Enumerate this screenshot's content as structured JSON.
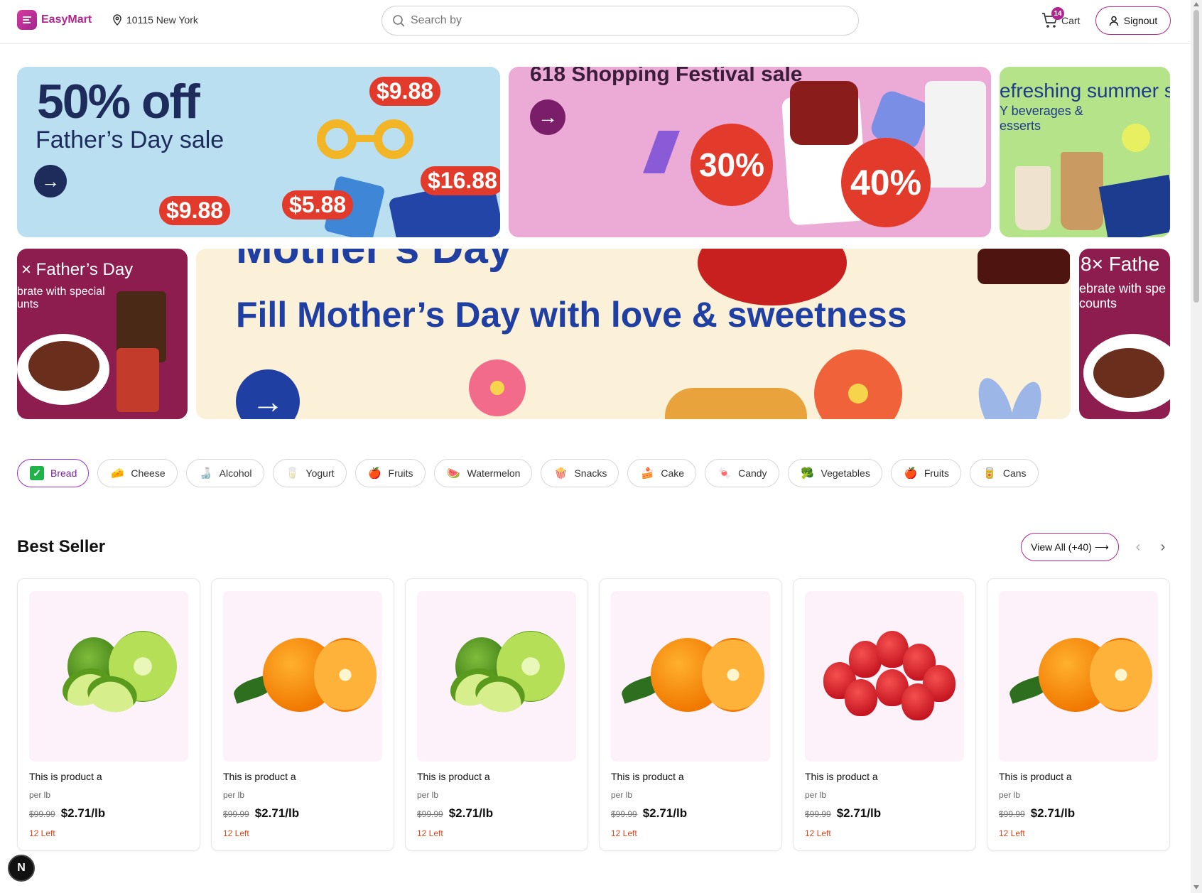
{
  "app": {
    "name": "EasyMart",
    "brand_color": "#b0268e"
  },
  "header": {
    "location": "10115 New York",
    "search_placeholder": "Search by",
    "cart_label": "Cart",
    "cart_count": "14",
    "signout_label": "Signout"
  },
  "banners": {
    "fathers_sale": {
      "headline": "50% off",
      "subtitle": "Father’s Day sale",
      "prices": [
        "$9.88",
        "$9.88",
        "$5.88",
        "$16.88"
      ]
    },
    "festival": {
      "title": "618 Shopping Festival sale",
      "discount_1": "30%",
      "discount_2": "40%"
    },
    "summer": {
      "title": "efreshing summer s",
      "subtitle_1": "Y beverages &",
      "subtitle_2": "esserts"
    },
    "fathers_left": {
      "title": "× Father’s Day",
      "subtitle_1": "brate with special",
      "subtitle_2": "unts"
    },
    "mothers": {
      "title": "Mother’s Day",
      "headline": "Fill Mother’s Day with love & sweetness"
    },
    "fathers_right": {
      "title": "8× Fathe",
      "subtitle_1": "ebrate with spe",
      "subtitle_2": "counts"
    }
  },
  "categories": [
    {
      "label": "Bread",
      "icon": "check-icon",
      "active": true
    },
    {
      "label": "Cheese",
      "icon": "cheese-icon"
    },
    {
      "label": "Alcohol",
      "icon": "alcohol-icon"
    },
    {
      "label": "Yogurt",
      "icon": "yogurt-icon"
    },
    {
      "label": "Fruits",
      "icon": "apple-icon"
    },
    {
      "label": "Watermelon",
      "icon": "watermelon-icon"
    },
    {
      "label": "Snacks",
      "icon": "popcorn-icon"
    },
    {
      "label": "Cake",
      "icon": "cake-icon"
    },
    {
      "label": "Candy",
      "icon": "candy-icon"
    },
    {
      "label": "Vegetables",
      "icon": "broccoli-icon"
    },
    {
      "label": "Fruits",
      "icon": "apple-icon"
    },
    {
      "label": "Cans",
      "icon": "can-icon"
    }
  ],
  "best_seller": {
    "title": "Best Seller",
    "view_all": "View All (+40) ⟶",
    "products": [
      {
        "name": "This is product a",
        "unit": "per lb",
        "old_price": "$99.99",
        "price": "$2.71/lb",
        "stock": "12 Left",
        "image": "lime"
      },
      {
        "name": "This is product a",
        "unit": "per lb",
        "old_price": "$99.99",
        "price": "$2.71/lb",
        "stock": "12 Left",
        "image": "orange"
      },
      {
        "name": "This is product a",
        "unit": "per lb",
        "old_price": "$99.99",
        "price": "$2.71/lb",
        "stock": "12 Left",
        "image": "lime"
      },
      {
        "name": "This is product a",
        "unit": "per lb",
        "old_price": "$99.99",
        "price": "$2.71/lb",
        "stock": "12 Left",
        "image": "orange"
      },
      {
        "name": "This is product a",
        "unit": "per lb",
        "old_price": "$99.99",
        "price": "$2.71/lb",
        "stock": "12 Left",
        "image": "strawberry"
      },
      {
        "name": "This is product a",
        "unit": "per lb",
        "old_price": "$99.99",
        "price": "$2.71/lb",
        "stock": "12 Left",
        "image": "orange"
      }
    ]
  },
  "dev_badge": "N"
}
